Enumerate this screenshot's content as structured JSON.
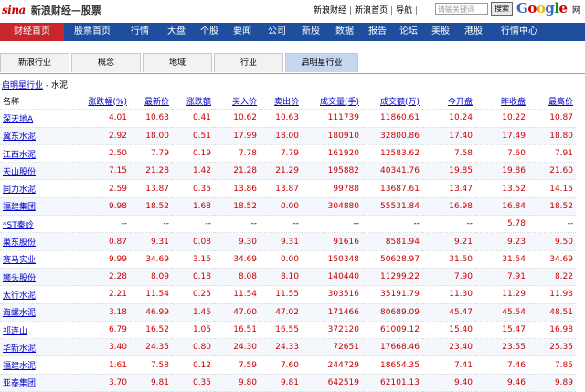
{
  "header": {
    "logo_text": "sina",
    "title": "新浪财经—股票",
    "links": [
      "新浪财经",
      "新浪首页",
      "导航"
    ],
    "search_placeholder": "请输关键词",
    "search_button": "搜索",
    "google": "Google",
    "right_text": "网"
  },
  "nav": {
    "items": [
      "财经首页",
      "股票首页",
      "行情",
      "大盘",
      "个股",
      "要闻",
      "公司",
      "新股",
      "数据",
      "报告",
      "论坛",
      "美股",
      "港股",
      "行情中心"
    ],
    "active_index": 0
  },
  "subnav": {
    "tabs": [
      "新浪行业",
      "概念",
      "地域",
      "行业",
      "启明星行业"
    ],
    "active_index": 4
  },
  "breadcrumb": {
    "link": "启明星行业",
    "separator": " - ",
    "current": "水泥"
  },
  "table": {
    "columns": [
      "名称",
      "涨跌幅(%)",
      "最新价",
      "涨跌额",
      "买入价",
      "卖出价",
      "成交量(手)",
      "成交额(万)",
      "今开盘",
      "昨收盘",
      "最高价"
    ],
    "rows": [
      [
        "深天地A",
        "4.01",
        "10.63",
        "0.41",
        "10.62",
        "10.63",
        "111739",
        "11860.61",
        "10.24",
        "10.22",
        "10.87"
      ],
      [
        "冀东水泥",
        "2.92",
        "18.00",
        "0.51",
        "17.99",
        "18.00",
        "180910",
        "32800.86",
        "17.40",
        "17.49",
        "18.80"
      ],
      [
        "江西水泥",
        "2.50",
        "7.79",
        "0.19",
        "7.78",
        "7.79",
        "161920",
        "12583.62",
        "7.58",
        "7.60",
        "7.91"
      ],
      [
        "天山股份",
        "7.15",
        "21.28",
        "1.42",
        "21.28",
        "21.29",
        "195882",
        "40341.76",
        "19.85",
        "19.86",
        "21.60"
      ],
      [
        "同力水泥",
        "2.59",
        "13.87",
        "0.35",
        "13.86",
        "13.87",
        "99788",
        "13687.61",
        "13.47",
        "13.52",
        "14.15"
      ],
      [
        "福建集团",
        "9.98",
        "18.52",
        "1.68",
        "18.52",
        "0.00",
        "304880",
        "55531.84",
        "16.98",
        "16.84",
        "18.52"
      ],
      [
        "*ST秦岭",
        "--",
        "--",
        "--",
        "--",
        "--",
        "--",
        "--",
        "--",
        "5.78",
        "--"
      ],
      [
        "巢东股份",
        "0.87",
        "9.31",
        "0.08",
        "9.30",
        "9.31",
        "91616",
        "8581.94",
        "9.21",
        "9.23",
        "9.50"
      ],
      [
        "赛马实业",
        "9.99",
        "34.69",
        "3.15",
        "34.69",
        "0.00",
        "150348",
        "50628.97",
        "31.50",
        "31.54",
        "34.69"
      ],
      [
        "狮头股份",
        "2.28",
        "8.09",
        "0.18",
        "8.08",
        "8.10",
        "140440",
        "11299.22",
        "7.90",
        "7.91",
        "8.22"
      ],
      [
        "太行水泥",
        "2.21",
        "11.54",
        "0.25",
        "11.54",
        "11.55",
        "303516",
        "35191.79",
        "11.30",
        "11.29",
        "11.93"
      ],
      [
        "海螺水泥",
        "3.18",
        "46.99",
        "1.45",
        "47.00",
        "47.02",
        "171466",
        "80689.09",
        "45.47",
        "45.54",
        "48.51"
      ],
      [
        "祁连山",
        "6.79",
        "16.52",
        "1.05",
        "16.51",
        "16.55",
        "372120",
        "61009.12",
        "15.40",
        "15.47",
        "16.98"
      ],
      [
        "华新水泥",
        "3.40",
        "24.35",
        "0.80",
        "24.30",
        "24.33",
        "72651",
        "17668.46",
        "23.40",
        "23.55",
        "25.35"
      ],
      [
        "福建水泥",
        "1.61",
        "7.58",
        "0.12",
        "7.59",
        "7.60",
        "244729",
        "18654.35",
        "7.41",
        "7.46",
        "7.85"
      ],
      [
        "亚泰集团",
        "3.70",
        "9.81",
        "0.35",
        "9.80",
        "9.81",
        "642519",
        "62101.13",
        "9.40",
        "9.46",
        "9.89"
      ]
    ]
  },
  "colors": {
    "nav_bg": "#1e4f9f",
    "nav_active": "#c8262a",
    "up": "#cc0000",
    "link": "#0000cc"
  }
}
